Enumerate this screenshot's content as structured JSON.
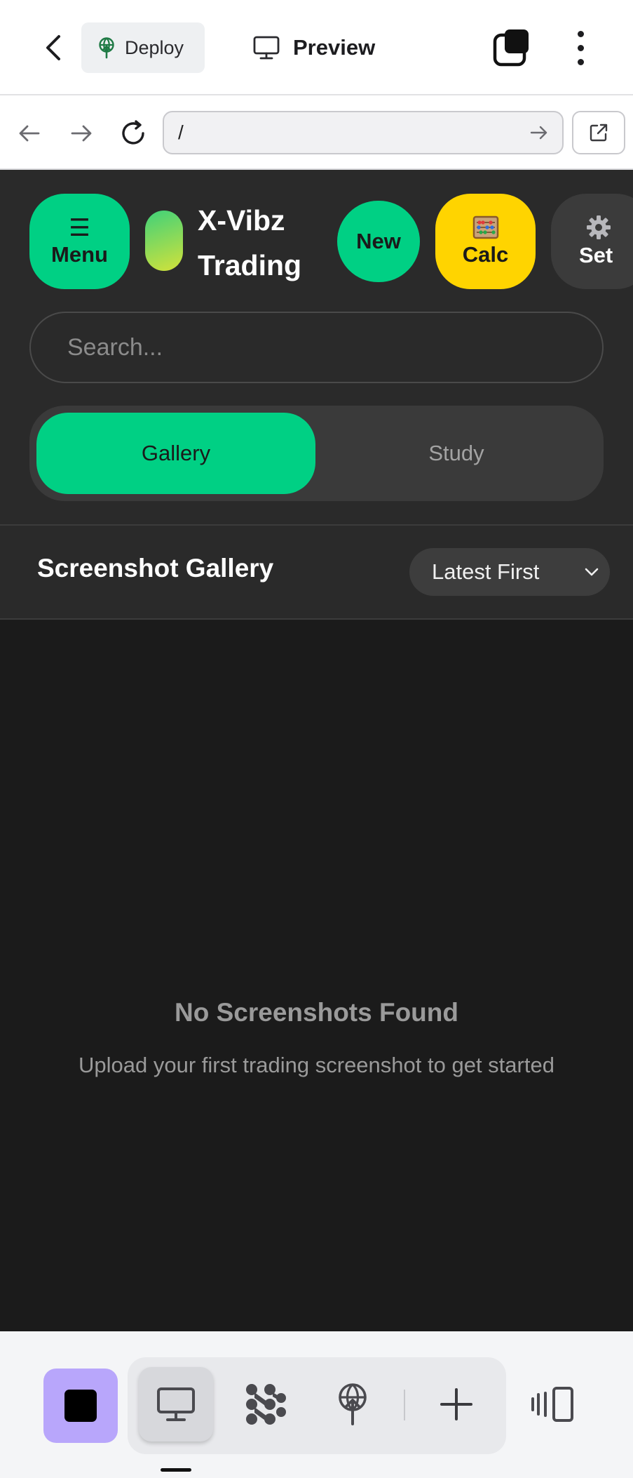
{
  "topbar": {
    "deploy_label": "Deploy",
    "preview_label": "Preview"
  },
  "urlbar": {
    "url": "/"
  },
  "app": {
    "menu": {
      "icon": "☰",
      "label": "Menu"
    },
    "title": "X-Vibz Trading",
    "new_label": "New",
    "calc": {
      "icon": "abacus-icon",
      "label": "Calc"
    },
    "settings": {
      "icon": "gear-icon",
      "label": "Set"
    },
    "search_placeholder": "Search...",
    "tabs": [
      {
        "label": "Gallery",
        "active": true
      },
      {
        "label": "Study",
        "active": false
      }
    ],
    "gallery": {
      "title": "Screenshot Gallery",
      "sort_value": "Latest First"
    },
    "empty": {
      "title": "No Screenshots Found",
      "subtitle": "Upload your first trading screenshot to get started"
    }
  },
  "dock": {
    "items": [
      "stop-icon",
      "desktop-icon",
      "connections-icon",
      "deploy-icon",
      "add-icon",
      "split-view-icon"
    ]
  },
  "colors": {
    "accent_green": "#00d084",
    "calc_yellow": "#ffd400",
    "app_bg": "#1b1b1b",
    "panel_bg": "#2a2a2a",
    "dock_stop": "#b8a6fb"
  }
}
